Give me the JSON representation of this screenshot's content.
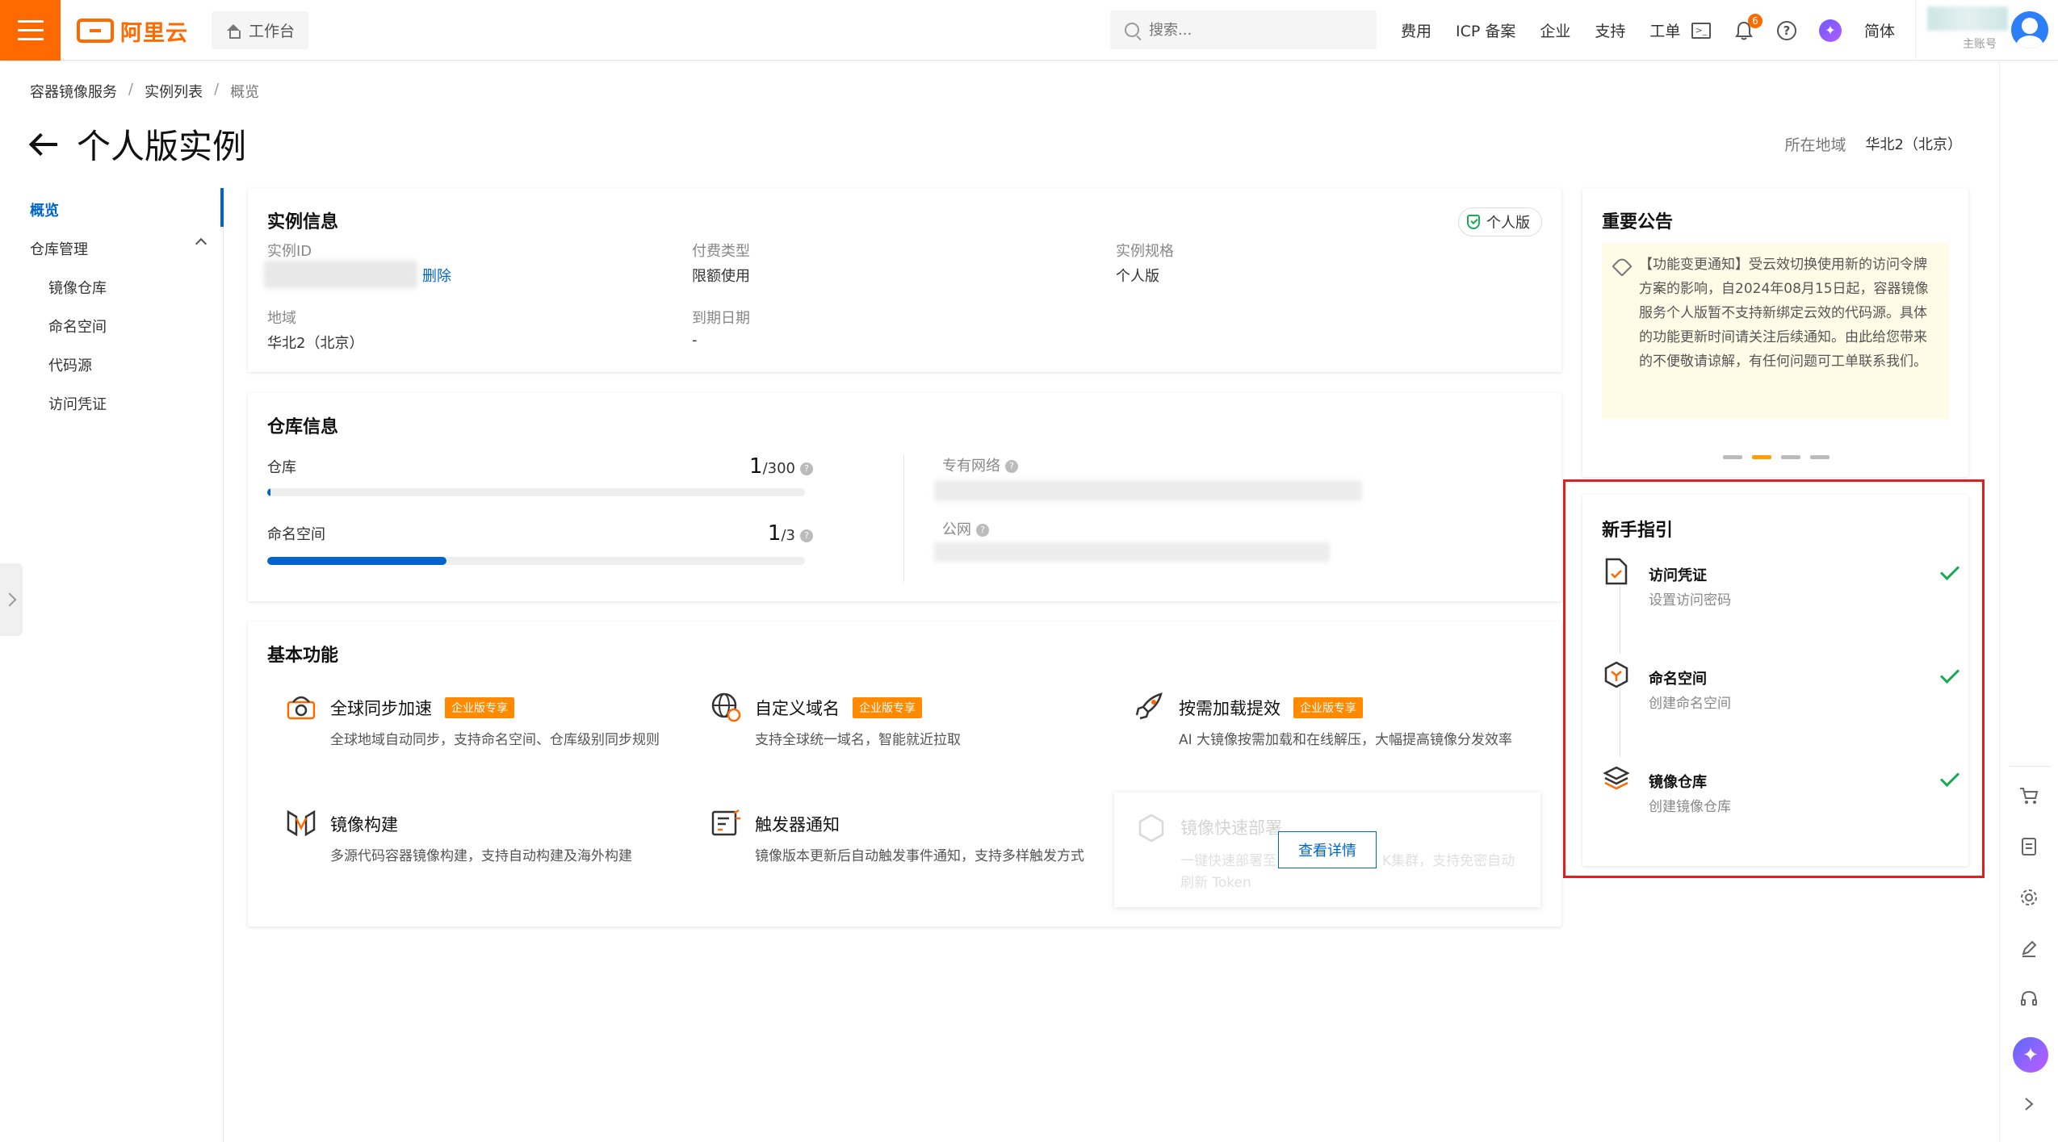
{
  "topbar": {
    "logo_text": "阿里云",
    "workbench": "工作台",
    "search_placeholder": "搜索...",
    "links": [
      "费用",
      "ICP 备案",
      "企业",
      "支持",
      "工单"
    ],
    "bell_count": "6",
    "language": "简体",
    "account_label": "主账号"
  },
  "breadcrumb": [
    "容器镜像服务",
    "实例列表",
    "概览"
  ],
  "page_title": "个人版实例",
  "region": {
    "label": "所在地域",
    "value": "华北2（北京）"
  },
  "sidebar": {
    "overview": "概览",
    "repo_mgmt": "仓库管理",
    "items": [
      "镜像仓库",
      "命名空间",
      "代码源",
      "访问凭证"
    ]
  },
  "instance_info": {
    "title": "实例信息",
    "badge": "个人版",
    "id_label": "实例ID",
    "delete_link": "删除",
    "pay_label": "付费类型",
    "pay_value": "限额使用",
    "spec_label": "实例规格",
    "spec_value": "个人版",
    "region_label": "地域",
    "region_value": "华北2（北京）",
    "expire_label": "到期日期",
    "expire_value": "-"
  },
  "repo_info": {
    "title": "仓库信息",
    "repo_label": "仓库",
    "repo_used": "1",
    "repo_total": "/300",
    "repo_fraction": 0.0033,
    "ns_label": "命名空间",
    "ns_used": "1",
    "ns_total": "/3",
    "ns_fraction": 0.333,
    "vpc_label": "专有网络",
    "public_label": "公网"
  },
  "basic_features": {
    "title": "基本功能",
    "enterprise_tag": "企业版专享",
    "items": [
      {
        "name": "全球同步加速",
        "desc": "全球地域自动同步，支持命名空间、仓库级别同步规则"
      },
      {
        "name": "自定义域名",
        "desc": "支持全球统一域名，智能就近拉取"
      },
      {
        "name": "按需加载提效",
        "desc": "AI 大镜像按需加载和在线解压，大幅提高镜像分发效率"
      },
      {
        "name": "镜像构建",
        "desc": "多源代码容器镜像构建，支持自动构建及海外构建"
      },
      {
        "name": "触发器通知",
        "desc": "镜像版本更新后自动触发事件通知，支持多样触发方式"
      },
      {
        "name": "镜像快速部署",
        "desc_a": "一键快速部署至",
        "desc_b": "K集群，支持免密自动",
        "desc_c": "刷新 Token"
      }
    ],
    "detail_button": "查看详情"
  },
  "notice": {
    "title": "重要公告",
    "text": "【功能变更通知】受云效切换使用新的访问令牌方案的影响，自2024年08月15日起，容器镜像服务个人版暂不支持新绑定云效的代码源。具体的功能更新时间请关注后续通知。由此给您带来的不便敬请谅解，有任何问题可工单联系我们。"
  },
  "guide": {
    "title": "新手指引",
    "items": [
      {
        "name": "访问凭证",
        "sub": "设置访问密码"
      },
      {
        "name": "命名空间",
        "sub": "创建命名空间"
      },
      {
        "name": "镜像仓库",
        "sub": "创建镜像仓库"
      }
    ]
  },
  "colors": {
    "brand": "#ff6a00",
    "primary": "#0064c8",
    "success": "#1aaa55",
    "highlight": "#e02020"
  }
}
